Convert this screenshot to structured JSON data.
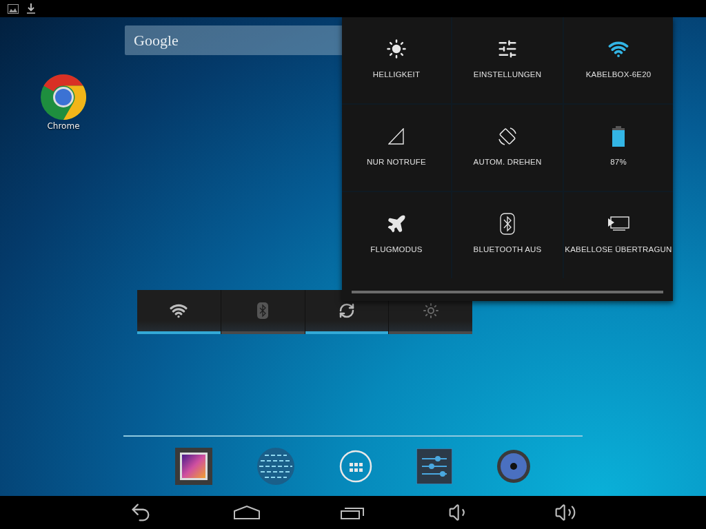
{
  "search_widget": {
    "label": "Google"
  },
  "desktop_icons": [
    {
      "kind": "browser",
      "label": "Chrome"
    }
  ],
  "power_widget": {
    "toggles": [
      {
        "kind": "wifi",
        "on": true
      },
      {
        "kind": "bluetooth",
        "on": false
      },
      {
        "kind": "sync",
        "on": true
      },
      {
        "kind": "brightness",
        "on": false
      }
    ]
  },
  "quick_settings": {
    "tiles": [
      {
        "kind": "brightness",
        "label": "HELLIGKEIT"
      },
      {
        "kind": "settings",
        "label": "EINSTELLUNGEN"
      },
      {
        "kind": "wifi",
        "label": "KABELBOX-6E20"
      },
      {
        "kind": "signal",
        "label": "NUR NOTRUFE"
      },
      {
        "kind": "rotate",
        "label": "AUTOM. DREHEN"
      },
      {
        "kind": "battery",
        "label": "87%"
      },
      {
        "kind": "airplane",
        "label": "FLUGMODUS"
      },
      {
        "kind": "bluetooth",
        "label": "BLUETOOTH AUS"
      },
      {
        "kind": "cast",
        "label": "KABELLOSE ÜBERTRAGUN"
      }
    ]
  },
  "dock": [
    {
      "kind": "gallery"
    },
    {
      "kind": "globe"
    },
    {
      "kind": "apps"
    },
    {
      "kind": "settings"
    },
    {
      "kind": "music"
    }
  ],
  "nav_bar": [
    {
      "kind": "back"
    },
    {
      "kind": "home"
    },
    {
      "kind": "recents"
    },
    {
      "kind": "volume_down"
    },
    {
      "kind": "volume_up"
    }
  ]
}
